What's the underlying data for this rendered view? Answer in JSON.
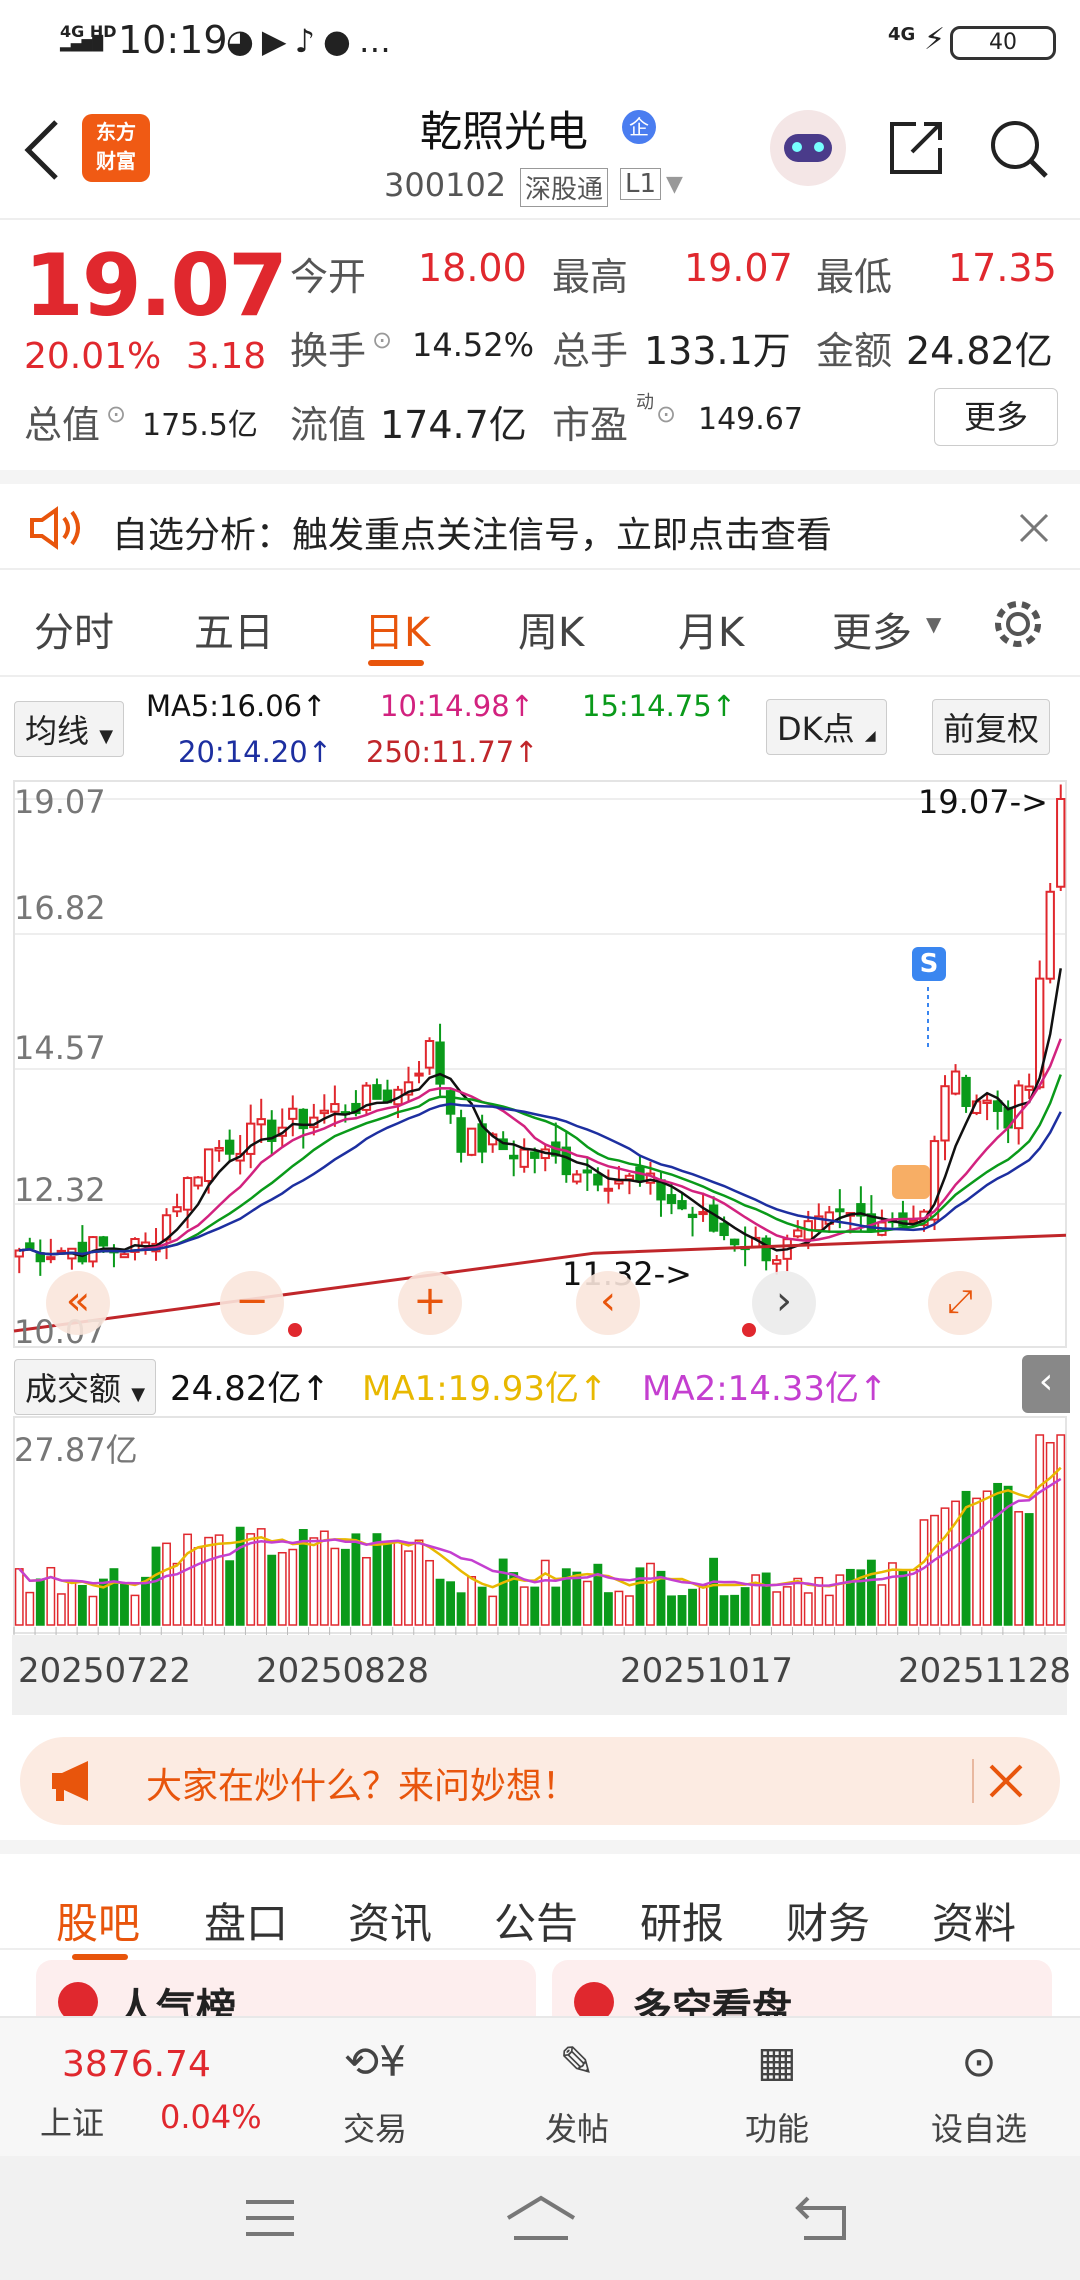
{
  "status": {
    "time": "10:19",
    "network": "4G HD",
    "battery": "40",
    "right_net": "4G"
  },
  "header": {
    "title": "乾照光电",
    "code": "300102",
    "exchange_badge": "深股通",
    "level_badge": "L1",
    "logo_line1": "东方",
    "logo_line2": "财富",
    "enterprise_badge": "企"
  },
  "quote": {
    "price": "19.07",
    "change_pct": "20.01%",
    "change": "3.18",
    "open_label": "今开",
    "open": "18.00",
    "high_label": "最高",
    "high": "19.07",
    "low_label": "最低",
    "low": "17.35",
    "turnover_label": "换手",
    "turnover": "14.52%",
    "volume_label": "总手",
    "volume": "133.1万",
    "amount_label": "金额",
    "amount": "24.82亿",
    "mcap_label": "总值",
    "mcap": "175.5亿",
    "float_label": "流值",
    "float": "174.7亿",
    "pe_label": "市盈",
    "pe_sup": "动",
    "pe": "149.67",
    "more_button": "更多"
  },
  "notice": {
    "text": "自选分析：触发重点关注信号，立即点击查看"
  },
  "tabs": {
    "items": [
      "分时",
      "五日",
      "日K",
      "周K",
      "月K",
      "更多"
    ],
    "active": "日K"
  },
  "ma": {
    "select": "均线",
    "ma5": "MA5:16.06↑",
    "ma10": "10:14.98↑",
    "ma15": "15:14.75↑",
    "ma20": "20:14.20↑",
    "ma250": "250:11.77↑",
    "dk_button": "DK点",
    "fq_button": "前复权"
  },
  "kchart": {
    "y_labels": [
      "19.07",
      "16.82",
      "14.57",
      "12.32",
      "10.07"
    ],
    "high_marker": "19.07->",
    "low_marker": "11.32->",
    "signal": "S"
  },
  "volume": {
    "select": "成交额",
    "value": "24.82亿↑",
    "ma1": "MA1:19.93亿↑",
    "ma2": "MA2:14.33亿↑",
    "max_label": "27.87亿"
  },
  "dates": [
    "20250722",
    "20250828",
    "20251017",
    "20251128"
  ],
  "banner": {
    "text": "大家在炒什么？来问妙想！"
  },
  "subtabs": {
    "items": [
      "股吧",
      "盘口",
      "资讯",
      "公告",
      "研报",
      "财务",
      "资料"
    ],
    "active": "股吧"
  },
  "cards": {
    "left": "人气榜",
    "right": "多空看盘"
  },
  "bottom": {
    "index_value": "3876.74",
    "index_name": "上证",
    "index_change": "0.04%",
    "nav": [
      "交易",
      "发帖",
      "功能",
      "设自选"
    ]
  },
  "colors": {
    "up": "#e0282e",
    "down": "#0a9a1a",
    "accent": "#e8550c",
    "ma5": "#111111",
    "ma10": "#d2227f",
    "ma15": "#0a9a1a",
    "ma20": "#1d2fa0",
    "ma250": "#c0262a"
  }
}
